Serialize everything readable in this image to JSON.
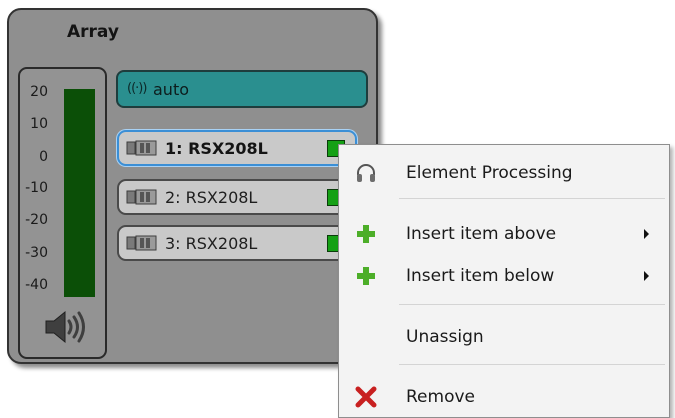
{
  "panel": {
    "title": "Array"
  },
  "meter": {
    "scale": [
      "20",
      "10",
      "0",
      "-10",
      "-20",
      "-30",
      "-40"
    ],
    "icon": "speaker-volume-icon"
  },
  "auto_button": {
    "label": "auto",
    "icon": "broadcast-icon"
  },
  "elements": [
    {
      "label": "1: RSX208L",
      "selected": true,
      "status_color": "#15a015",
      "icon": "speaker-cabinet-icon"
    },
    {
      "label": "2: RSX208L",
      "selected": false,
      "status_color": "#15a015",
      "icon": "speaker-cabinet-icon"
    },
    {
      "label": "3: RSX208L",
      "selected": false,
      "status_color": "#15a015",
      "icon": "speaker-cabinet-icon"
    }
  ],
  "context_menu": {
    "items": [
      {
        "label": "Element Processing",
        "icon": "headphones-icon",
        "has_submenu": false
      },
      {
        "label": "Insert item above",
        "icon": "green-plus-icon",
        "has_submenu": true
      },
      {
        "label": "Insert item below",
        "icon": "green-plus-icon",
        "has_submenu": true
      },
      {
        "label": "Unassign",
        "icon": "",
        "has_submenu": false
      },
      {
        "label": "Remove",
        "icon": "red-x-icon",
        "has_submenu": false
      }
    ]
  },
  "colors": {
    "panel_bg": "#8f8f8f",
    "meter_green": "#0b4f07",
    "auto_teal": "#2a8f8f",
    "status_green": "#15a015",
    "selection_blue": "#3b8fd6",
    "remove_red": "#c82020",
    "plus_green": "#4cae28"
  }
}
